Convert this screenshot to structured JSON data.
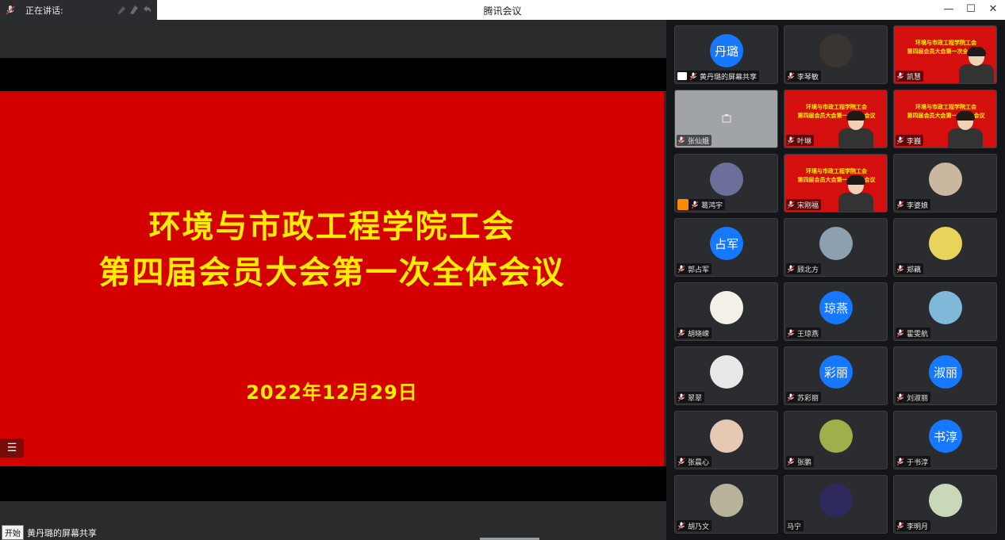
{
  "titlebar": {
    "app_title": "腾讯会议",
    "speaking_label": "正在讲话:",
    "controls": {
      "minimize": "—",
      "maximize": "☐",
      "close": "✕"
    }
  },
  "slide": {
    "line1": "环境与市政工程学院工会",
    "line2": "第四届会员大会第一次全体会议",
    "date": "2022年12月29日",
    "list_icon": "☰"
  },
  "caption": {
    "start": "开始",
    "text": "黄丹璐的屏幕共享"
  },
  "video_text": {
    "line1": "环境与市政工程学院工会",
    "line2": "第四届会员大会第一次全体会议"
  },
  "participants": [
    {
      "name": "黄丹璐的屏幕共享",
      "avatar_text": "丹璐",
      "type": "text",
      "screen": true
    },
    {
      "name": "李琴敏",
      "type": "photo",
      "photo_color": "#3a3530"
    },
    {
      "name": "凯慧",
      "type": "video"
    },
    {
      "name": "张仙娥",
      "type": "gray"
    },
    {
      "name": "叶琳",
      "type": "video"
    },
    {
      "name": "李巍",
      "type": "video"
    },
    {
      "name": "葛鸿宇",
      "type": "photo",
      "photo_color": "#6b6f9a",
      "user_icon": true
    },
    {
      "name": "宋刚福",
      "type": "video"
    },
    {
      "name": "李婆娘",
      "type": "photo",
      "photo_color": "#c9b7a0"
    },
    {
      "name": "郭占军",
      "avatar_text": "占军",
      "type": "text"
    },
    {
      "name": "顾北方",
      "type": "photo",
      "photo_color": "#8da0b0"
    },
    {
      "name": "郑藕",
      "type": "photo",
      "photo_color": "#e8d45a"
    },
    {
      "name": "胡晓嵘",
      "type": "photo",
      "photo_color": "#f3f0e8"
    },
    {
      "name": "王琼燕",
      "avatar_text": "琼燕",
      "type": "text"
    },
    {
      "name": "霍雯航",
      "type": "photo",
      "photo_color": "#7fb8d8"
    },
    {
      "name": "翠翠",
      "type": "photo",
      "photo_color": "#e8e8e8"
    },
    {
      "name": "苏彩丽",
      "avatar_text": "彩丽",
      "type": "text"
    },
    {
      "name": "刘淑丽",
      "avatar_text": "淑丽",
      "type": "text"
    },
    {
      "name": "张晨心",
      "type": "photo",
      "photo_color": "#e6c9b3"
    },
    {
      "name": "张鹏",
      "type": "photo",
      "photo_color": "#9fb04a"
    },
    {
      "name": "于书淳",
      "avatar_text": "书淳",
      "type": "text"
    },
    {
      "name": "胡乃文",
      "type": "photo",
      "photo_color": "#b9b29a"
    },
    {
      "name": "马宁",
      "type": "photo",
      "photo_color": "#2e2a5e",
      "no_mic": true
    },
    {
      "name": "李明月",
      "type": "photo",
      "photo_color": "#c8d8b8"
    }
  ]
}
